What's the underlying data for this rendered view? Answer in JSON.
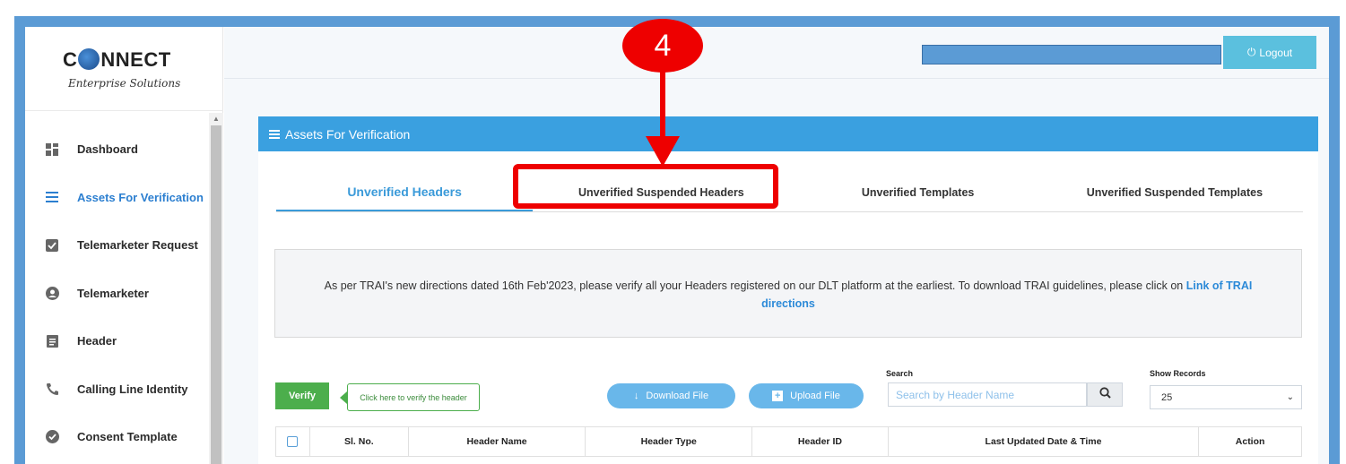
{
  "brand": {
    "logo_prefix": "C",
    "logo_suffix": "NNECT",
    "logo_sub": "Enterprise Solutions"
  },
  "sidebar": {
    "items": [
      {
        "label": "Dashboard",
        "icon": "dashboard-icon"
      },
      {
        "label": "Assets For Verification",
        "icon": "list-icon",
        "active": true
      },
      {
        "label": "Telemarketer Request",
        "icon": "clipboard-check-icon"
      },
      {
        "label": "Telemarketer",
        "icon": "user-circle-icon"
      },
      {
        "label": "Header",
        "icon": "document-icon"
      },
      {
        "label": "Calling Line Identity",
        "icon": "phone-icon"
      },
      {
        "label": "Consent Template",
        "icon": "check-circle-icon"
      }
    ]
  },
  "topbar": {
    "logout_label": "Logout"
  },
  "panel": {
    "title": "Assets For Verification"
  },
  "tabs": [
    {
      "label": "Unverified Headers",
      "active": true
    },
    {
      "label": "Unverified Suspended Headers"
    },
    {
      "label": "Unverified Templates"
    },
    {
      "label": "Unverified Suspended Templates"
    }
  ],
  "notice": {
    "text": "As per TRAI's new directions dated 16th Feb'2023, please verify all your Headers registered on our DLT platform at the earliest. To download TRAI guidelines, please click on ",
    "link": "Link of TRAI directions"
  },
  "actions": {
    "verify_label": "Verify",
    "verify_tooltip": "Click here to verify the header",
    "download_label": "Download File",
    "upload_label": "Upload File"
  },
  "search": {
    "label": "Search",
    "placeholder": "Search by Header Name"
  },
  "records": {
    "label": "Show Records",
    "value": "25"
  },
  "table": {
    "columns": [
      "Sl. No.",
      "Header Name",
      "Header Type",
      "Header ID",
      "Last Updated Date & Time",
      "Action"
    ]
  },
  "annotation": {
    "step": "4"
  },
  "colors": {
    "frame": "#5b9bd5",
    "panel_header": "#3aa0e0",
    "accent": "#3a9ad9",
    "verify": "#4cae4c",
    "annotation": "#ee0000"
  }
}
